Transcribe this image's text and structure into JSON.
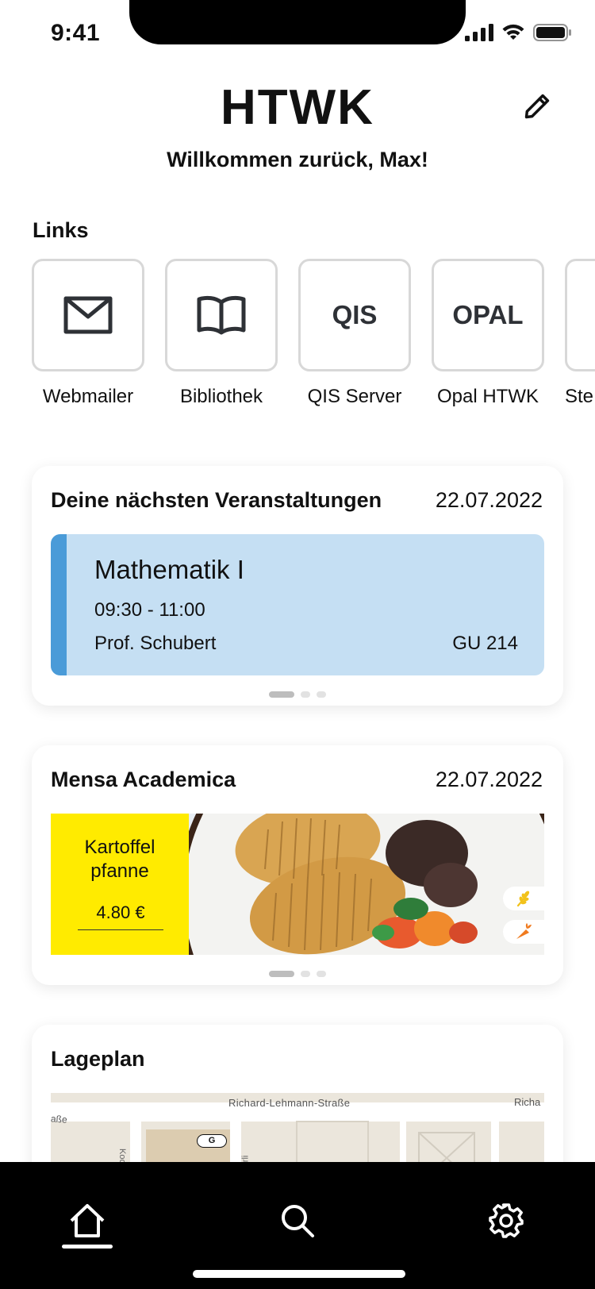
{
  "status_bar": {
    "time": "9:41"
  },
  "header": {
    "title": "HTWK",
    "welcome": "Willkommen zurück, Max!"
  },
  "links": {
    "title": "Links",
    "items": [
      {
        "label": "Webmailer",
        "icon": "mail-icon"
      },
      {
        "label": "Bibliothek",
        "icon": "book-icon"
      },
      {
        "label": "QIS Server",
        "tile_text": "QIS"
      },
      {
        "label": "Opal HTWK",
        "tile_text": "OPAL"
      },
      {
        "label": "Ste"
      }
    ]
  },
  "events": {
    "title": "Deine nächsten Veranstaltungen",
    "date": "22.07.2022",
    "current": {
      "name": "Mathematik I",
      "time": "09:30 - 11:00",
      "professor": "Prof. Schubert",
      "room": "GU 214",
      "accent_color": "#4a9bd8",
      "background_color": "#c5dff3"
    },
    "page_count": 3,
    "active_page": 1
  },
  "mensa": {
    "title": "Mensa Academica",
    "date": "22.07.2022",
    "meal": {
      "name_line1": "Kartoffel",
      "name_line2": "pfanne",
      "price": "4.80 €",
      "badges": [
        "wheat-icon",
        "carrot-icon"
      ]
    },
    "page_count": 3,
    "active_page": 1
  },
  "lageplan": {
    "title": "Lageplan",
    "map_labels": {
      "main_street": "Richard-Lehmann-Straße",
      "street_right": "Richa",
      "street_left": "aße",
      "side_street": "Kochstr",
      "side_street2": "arli",
      "marker": "G"
    }
  },
  "tabbar": {
    "tabs": [
      "home-icon",
      "search-icon",
      "settings-icon"
    ],
    "active": "home"
  },
  "colors": {
    "accent_yellow": "#ffeb00",
    "event_blue": "#4a9bd8",
    "tabbar": "#000000"
  }
}
